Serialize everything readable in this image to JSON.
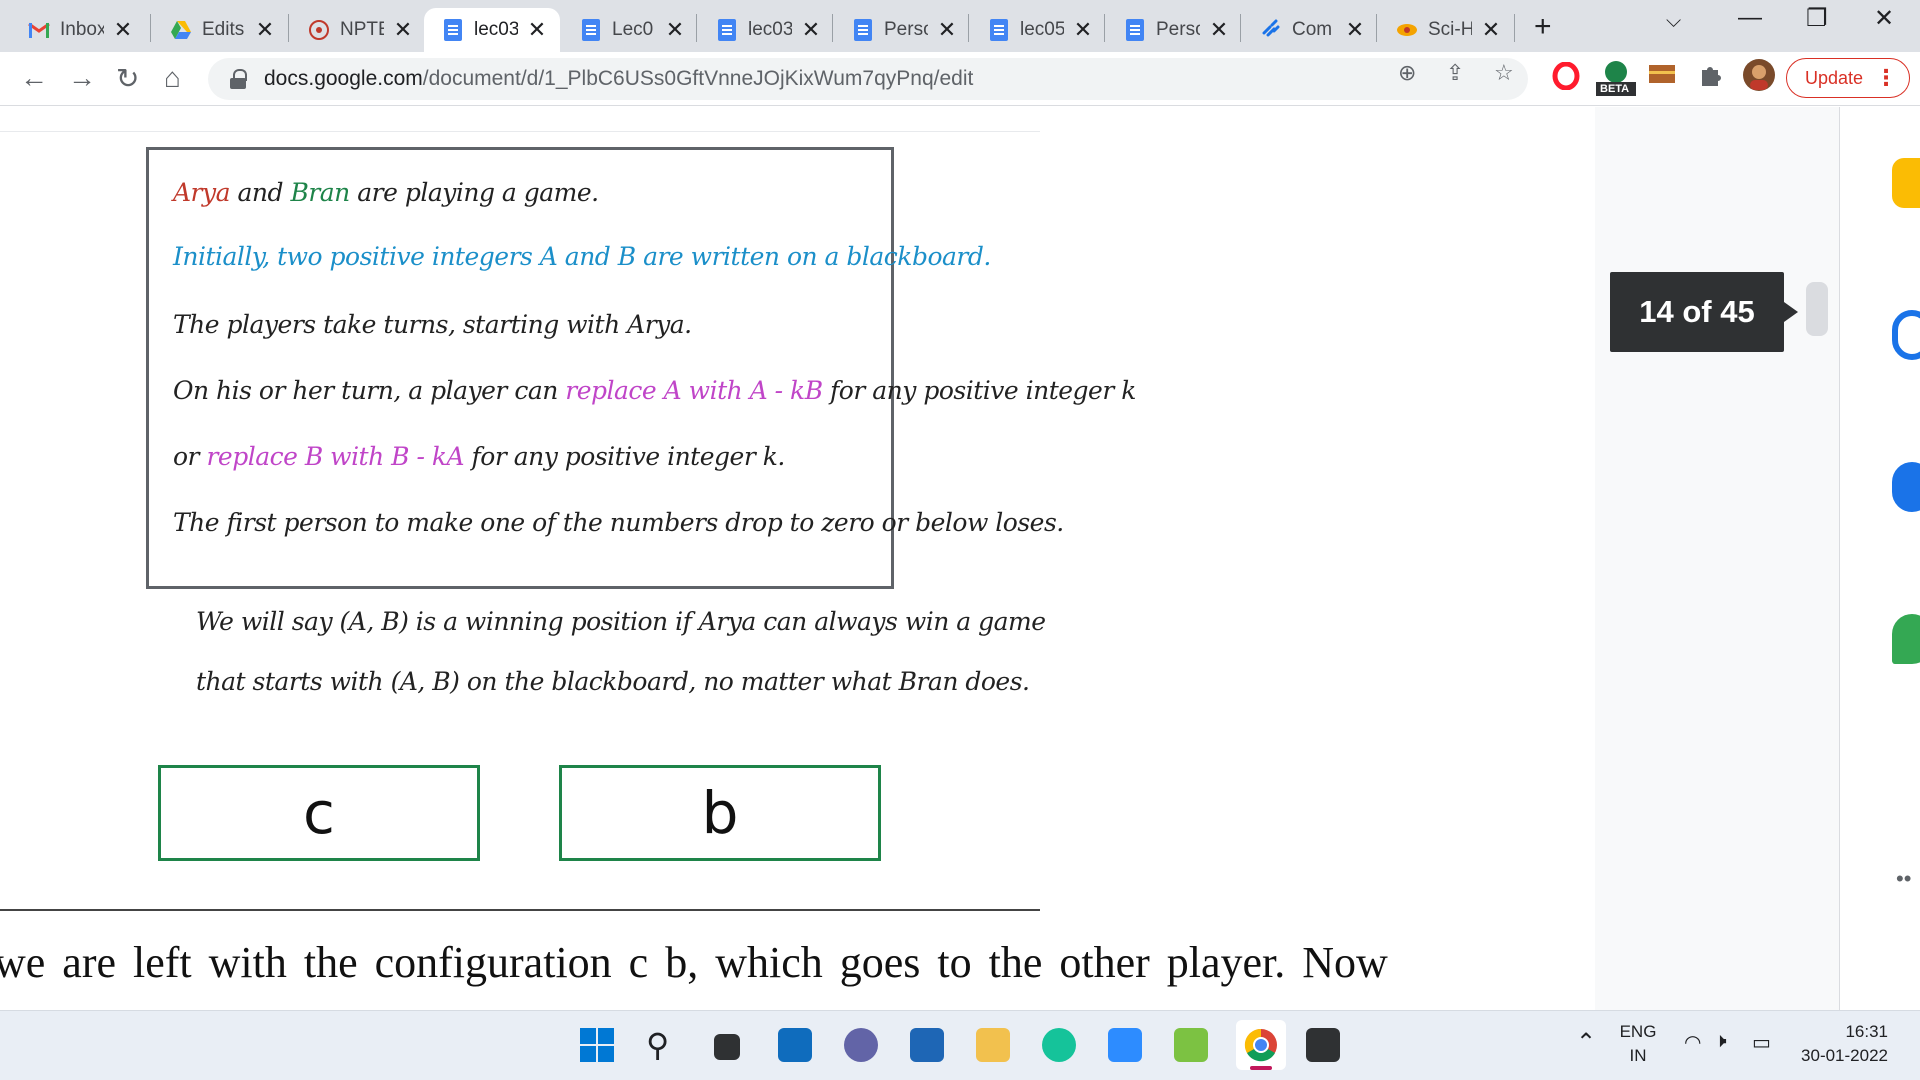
{
  "browser": {
    "tabs": [
      {
        "title": "Inbox",
        "icon": "gmail-icon",
        "active": false
      },
      {
        "title": "Edits",
        "icon": "drive-icon",
        "active": false
      },
      {
        "title": "NPTE",
        "icon": "nptel-icon",
        "active": false
      },
      {
        "title": "lec03",
        "icon": "docs-icon",
        "active": true
      },
      {
        "title": "Lec0",
        "icon": "docs-icon",
        "active": false
      },
      {
        "title": "lec03",
        "icon": "docs-icon",
        "active": false
      },
      {
        "title": "Perso",
        "icon": "docs-icon",
        "active": false
      },
      {
        "title": "lec05",
        "icon": "docs-icon",
        "active": false
      },
      {
        "title": "Perso",
        "icon": "docs-icon",
        "active": false
      },
      {
        "title": "Com",
        "icon": "link-icon",
        "active": false
      },
      {
        "title": "Sci-H",
        "icon": "scihub-icon",
        "active": false
      }
    ],
    "url_host": "docs.google.com",
    "url_path": "/document/d/1_PlbC6USs0GftVnneJOjKixWum7qyPnq/edit",
    "beta_label": "BETA",
    "update_label": "Update"
  },
  "slide": {
    "line1": {
      "a": "Arya",
      "b": " and ",
      "c": "Bran",
      "d": " are playing a game."
    },
    "line2": "Initially, two positive integers A and B are written on a blackboard.",
    "line3": "The players take turns, starting with Arya.",
    "line4": {
      "a": "On his or her turn, a player can ",
      "b": "replace A with A - kB",
      "c": " for any positive integer k"
    },
    "line5": {
      "a": "or ",
      "b": "replace B with B - kA",
      "c": " for any positive integer k."
    },
    "line6": "The first person to make one of the numbers drop to zero or below loses.",
    "under1": "We will say (A, B) is a winning position if Arya can always win a game",
    "under2": "that starts with (A, B) on the blackboard, no matter what Bran does.",
    "box_left": "c",
    "box_right": "b"
  },
  "body_text": "we are left with the configuration c b, which goes to the other player. Now",
  "page_indicator": "14 of 45",
  "taskbar": {
    "lang_top": "ENG",
    "lang_bottom": "IN",
    "time": "16:31",
    "date": "30-01-2022"
  },
  "colors": {
    "accent_red": "#c0392b",
    "accent_green": "#1e8449",
    "accent_blue": "#1b8fc9",
    "accent_magenta": "#c045c8",
    "box_border": "#1e8449"
  }
}
